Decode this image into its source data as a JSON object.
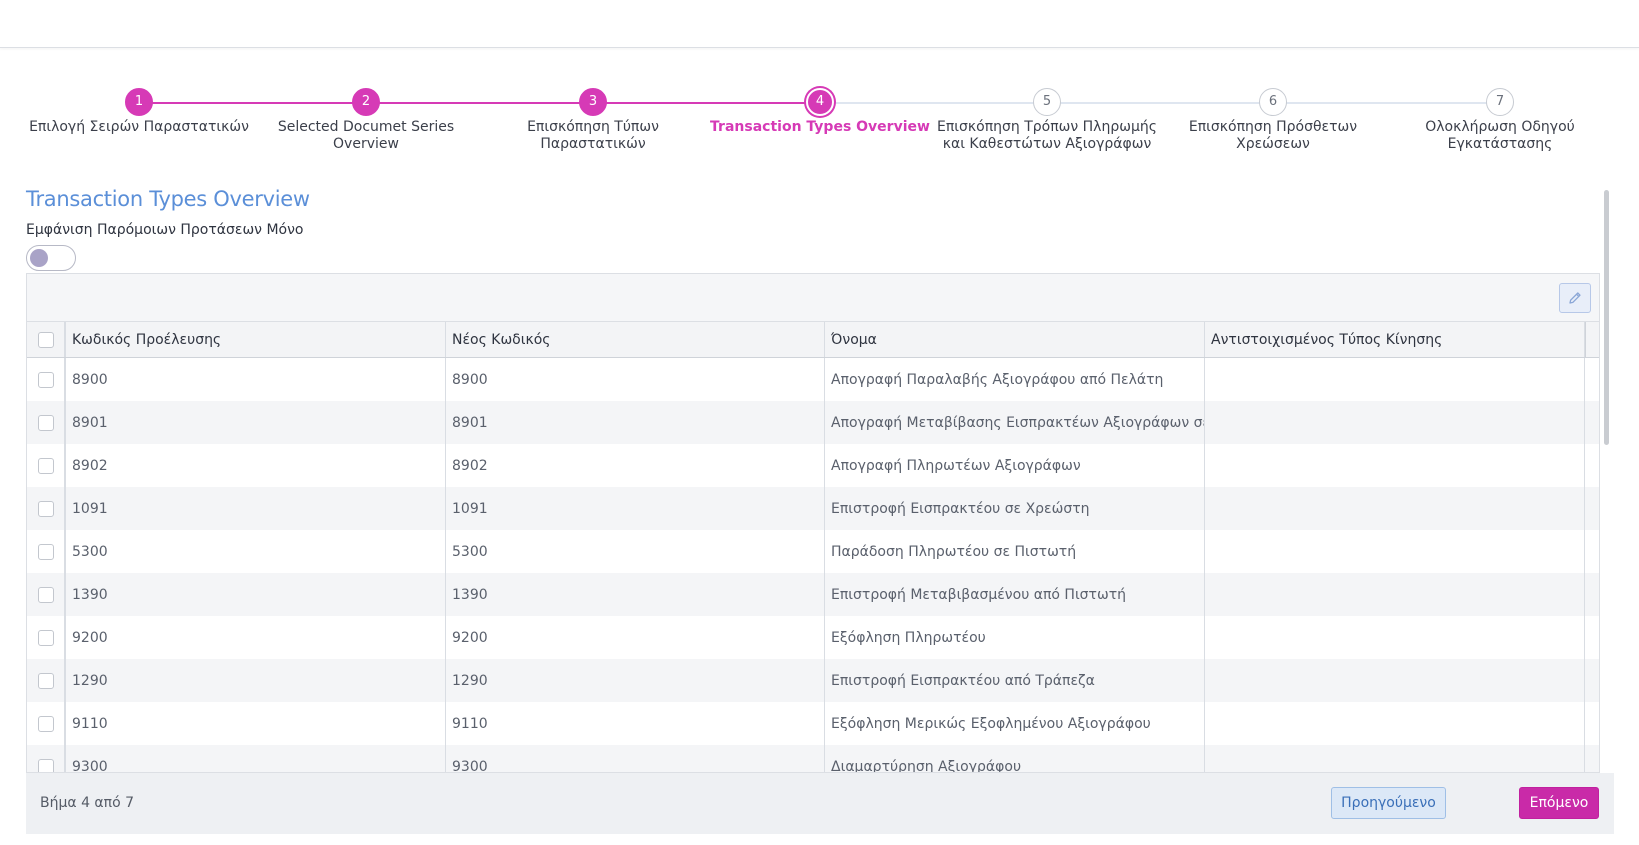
{
  "stepper": {
    "steps": [
      {
        "num": "1",
        "label": "Επιλογή Σειρών Παραστατικών"
      },
      {
        "num": "2",
        "label": "Selected Documet Series Overview"
      },
      {
        "num": "3",
        "label": "Επισκόπηση Τύπων Παραστατικών"
      },
      {
        "num": "4",
        "label": "Transaction Types Overview"
      },
      {
        "num": "5",
        "label": "Επισκόπηση Τρόπων Πληρωμής και Καθεστώτων Αξιογράφων"
      },
      {
        "num": "6",
        "label": "Επισκόπηση Πρόσθετων Χρεώσεων"
      },
      {
        "num": "7",
        "label": "Ολοκλήρωση Οδηγού Εγκατάστασης"
      }
    ],
    "current": 4
  },
  "page": {
    "title": "Transaction Types Overview",
    "toggle_label": "Εμφάνιση Παρόμοιων Προτάσεων Μόνο",
    "toggle_on": false
  },
  "table": {
    "columns": [
      "Κωδικός Προέλευσης",
      "Νέος Κωδικός",
      "Όνομα",
      "Αντιστοιχισμένος Τύπος Κίνησης"
    ],
    "rows": [
      {
        "source": "8900",
        "new": "8900",
        "name": "Απογραφή Παραλαβής Αξιογράφου από Πελάτη",
        "mapped": ""
      },
      {
        "source": "8901",
        "new": "8901",
        "name": "Απογραφή Μεταβίβασης Εισπρακτέων Αξιογράφων σε πρ",
        "mapped": ""
      },
      {
        "source": "8902",
        "new": "8902",
        "name": "Απογραφή Πληρωτέων Αξιογράφων",
        "mapped": ""
      },
      {
        "source": "1091",
        "new": "1091",
        "name": "Επιστροφή Εισπρακτέου σε Χρεώστη",
        "mapped": ""
      },
      {
        "source": "5300",
        "new": "5300",
        "name": "Παράδοση Πληρωτέου σε Πιστωτή",
        "mapped": ""
      },
      {
        "source": "1390",
        "new": "1390",
        "name": "Επιστροφή Μεταβιβασμένου από Πιστωτή",
        "mapped": ""
      },
      {
        "source": "9200",
        "new": "9200",
        "name": "Εξόφληση Πληρωτέου",
        "mapped": ""
      },
      {
        "source": "1290",
        "new": "1290",
        "name": "Επιστροφή Εισπρακτέου από Τράπεζα",
        "mapped": ""
      },
      {
        "source": "9110",
        "new": "9110",
        "name": "Εξόφληση Μερικώς Εξοφλημένου Αξιογράφου",
        "mapped": ""
      },
      {
        "source": "9300",
        "new": "9300",
        "name": "Διαμαρτύρηση Αξιογράφου",
        "mapped": ""
      }
    ]
  },
  "footer": {
    "step_text": "Βήμα 4 από 7",
    "prev_label": "Προηγούμενο",
    "next_label": "Επόμενο"
  },
  "colors": {
    "accent": "#d63ab6",
    "title": "#5b8fd8",
    "inactive_line": "#dfe6f0"
  }
}
